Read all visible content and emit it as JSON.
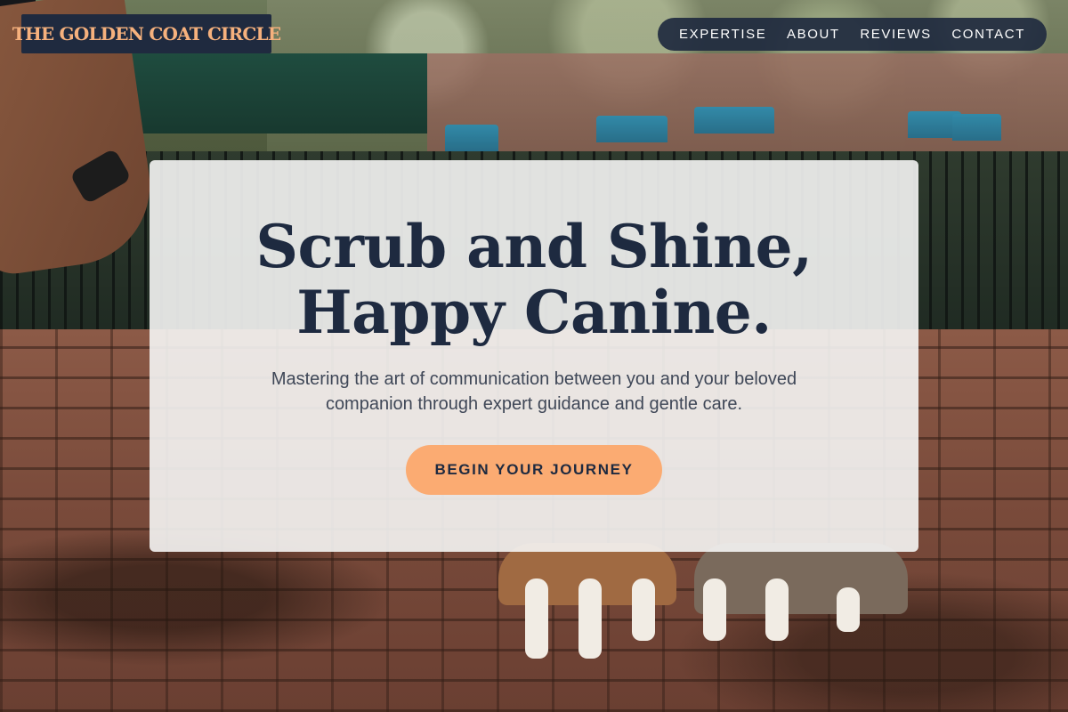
{
  "brand": {
    "name": "THE GOLDEN COAT CIRCLE"
  },
  "nav": {
    "items": [
      {
        "label": "EXPERTISE"
      },
      {
        "label": "ABOUT"
      },
      {
        "label": "REVIEWS"
      },
      {
        "label": "CONTACT"
      }
    ]
  },
  "hero": {
    "headline_line1": "Scrub and Shine,",
    "headline_line2": "Happy Canine.",
    "subtext": "Mastering the art of communication between you and your beloved companion through expert guidance and gentle care.",
    "cta_label": "BEGIN YOUR JOURNEY"
  },
  "colors": {
    "navy": "#1f2a3f",
    "accent_peach": "#fbab72",
    "logo_text": "#f6b17d",
    "card_bg": "#f5f5f4"
  }
}
